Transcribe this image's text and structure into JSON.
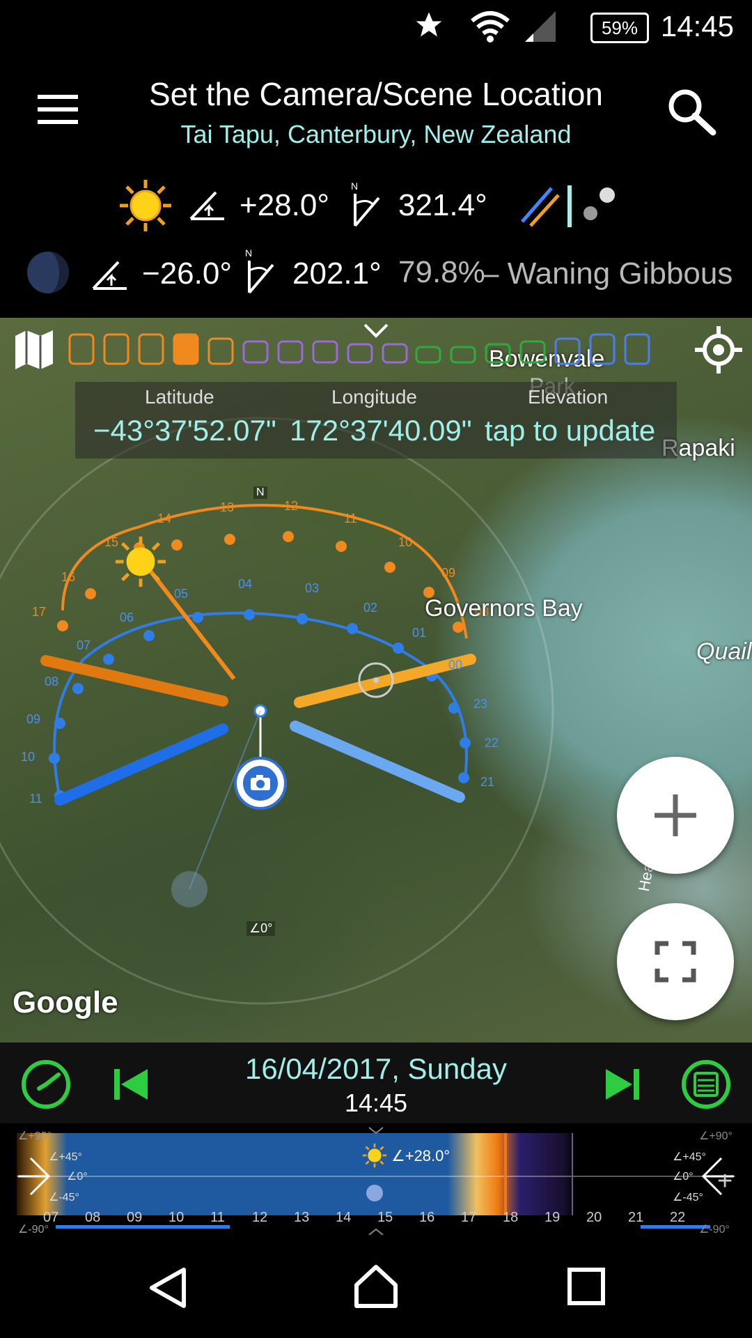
{
  "status": {
    "battery": "59%",
    "time": "14:45"
  },
  "header": {
    "title": "Set the Camera/Scene Location",
    "subtitle": "Tai Tapu, Canterbury, New Zealand"
  },
  "sun": {
    "elevation": "+28.0°",
    "azimuth": "321.4°"
  },
  "moon": {
    "elevation": "−26.0°",
    "azimuth": "202.1°",
    "illumination": "79.8%",
    "phase_text": "– Waning Gibbous"
  },
  "location": {
    "latitude_label": "Latitude",
    "latitude": "−43°37'52.07\"",
    "longitude_label": "Longitude",
    "longitude": "172°37'40.09\"",
    "elevation_label": "Elevation",
    "elevation_value": "tap to update"
  },
  "map_labels": {
    "bowenvale": "Bowenvale",
    "park": "Park",
    "rapaki": "Rapaki",
    "governors_bay": "Governors Bay",
    "quail": "Quail",
    "head": "Hea",
    "north": "N",
    "angle": "∠0°",
    "google": "Google"
  },
  "sun_hours": [
    "14",
    "13",
    "12",
    "11",
    "10",
    "09",
    "08",
    "15",
    "16",
    "17"
  ],
  "moon_hours": [
    "04",
    "03",
    "02",
    "01",
    "00",
    "05",
    "06",
    "07",
    "08",
    "09",
    "10",
    "11",
    "23",
    "22",
    "21"
  ],
  "datetime": {
    "date": "16/04/2017, Sunday",
    "time": "14:45"
  },
  "strip": {
    "hours": [
      "07",
      "08",
      "09",
      "10",
      "11",
      "12",
      "13",
      "14",
      "15",
      "16",
      "17",
      "18",
      "19",
      "20",
      "21",
      "22"
    ],
    "sun_label": "∠+28.0°",
    "left_angles": [
      "∠+90°",
      "∠+45°",
      "∠0°",
      "∠-45°",
      "∠-90°"
    ],
    "right_angles": [
      "∠+90°",
      "∠+45°",
      "∠0°",
      "∠-45°",
      "∠-90°"
    ]
  },
  "colors": {
    "accent_teal": "#9ff0ea",
    "green": "#2ecc40",
    "sun_orange": "#f08a1e",
    "moon_blue": "#2f7ee8"
  }
}
